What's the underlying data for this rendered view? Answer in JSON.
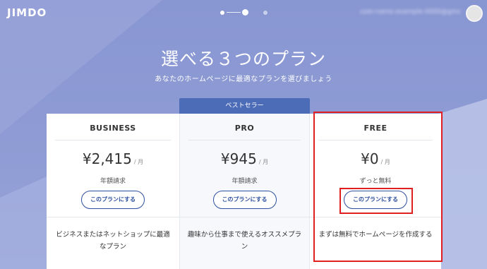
{
  "header": {
    "logo": "JIMDO",
    "user_email": "user.name.example.0000@gmail.com"
  },
  "hero": {
    "title": "選べる３つのプラン",
    "subtitle": "あなたのホームページに最適なプランを選びましょう"
  },
  "bestseller_label": "ベストセラー",
  "plans": [
    {
      "name": "BUSINESS",
      "price": "¥2,415",
      "per": "/ 月",
      "note": "年額請求",
      "button": "このプランにする",
      "description": "ビジネスまたはネットショップに最適なプラン"
    },
    {
      "name": "PRO",
      "price": "¥945",
      "per": "/ 月",
      "note": "年額請求",
      "button": "このプランにする",
      "description": "趣味から仕事まで使えるオススメプラン"
    },
    {
      "name": "FREE",
      "price": "¥0",
      "per": "/ 月",
      "note": "ずっと無料",
      "button": "このプランにする",
      "description": "まずは無料でホームページを作成する"
    }
  ],
  "colors": {
    "background": "#8896d2",
    "accent": "#2c4f9e",
    "bestseller": "#4d6cb8",
    "highlight": "#e02020"
  }
}
